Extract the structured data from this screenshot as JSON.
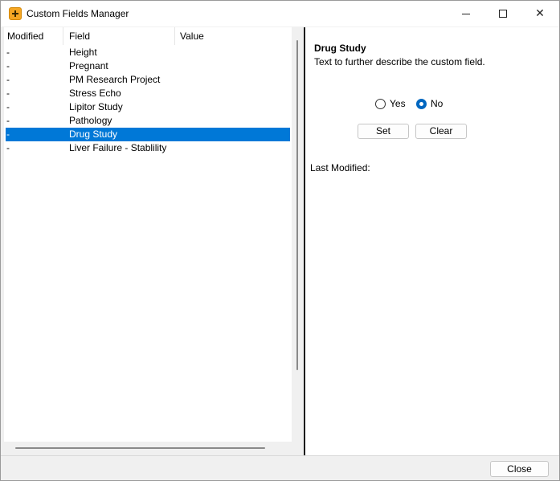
{
  "window": {
    "title": "Custom Fields Manager",
    "icon": "plus-app-icon",
    "controls": {
      "minimize": "minimize",
      "maximize": "maximize",
      "close": "close"
    }
  },
  "list": {
    "columns": [
      "Modified",
      "Field",
      "Value"
    ],
    "rows": [
      {
        "modified": "-",
        "field": "Height",
        "value": ""
      },
      {
        "modified": "-",
        "field": "Pregnant",
        "value": ""
      },
      {
        "modified": "-",
        "field": "PM Research Project",
        "value": ""
      },
      {
        "modified": "-",
        "field": "Stress Echo",
        "value": ""
      },
      {
        "modified": "-",
        "field": "Lipitor Study",
        "value": ""
      },
      {
        "modified": "-",
        "field": "Pathology",
        "value": ""
      },
      {
        "modified": "-",
        "field": "Drug Study",
        "value": "",
        "selected": true
      },
      {
        "modified": "-",
        "field": "Liver Failure - Stablility",
        "value": ""
      }
    ],
    "selected_color": "#0078d7"
  },
  "detail": {
    "title": "Drug Study",
    "description": "Text to further describe the custom field.",
    "options": {
      "yes": "Yes",
      "no": "No",
      "selected": "No"
    },
    "set_label": "Set",
    "clear_label": "Clear",
    "last_modified_label": "Last Modified:"
  },
  "footer": {
    "close_label": "Close"
  }
}
